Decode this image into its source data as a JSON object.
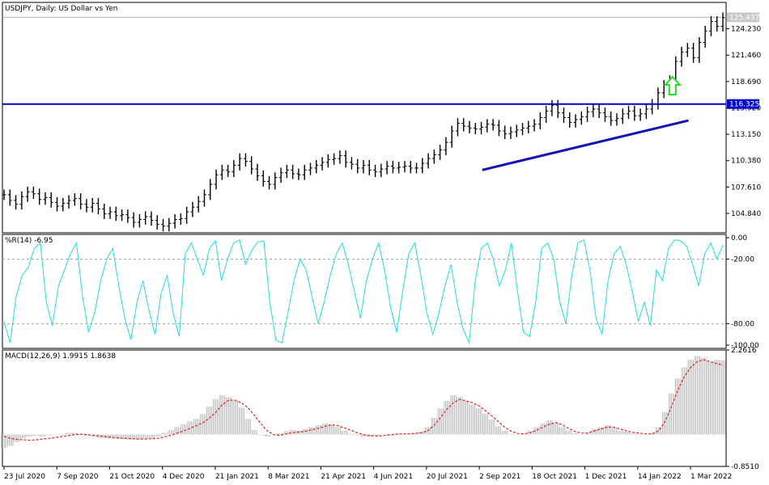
{
  "chart_data": [
    {
      "type": "line",
      "panel": "price",
      "title": "USDJPY, Daily:  US Dollar vs Yen",
      "price_tag": "125.437",
      "level_tag": "116.325",
      "level_value": 116.325,
      "last_value": 125.437,
      "ylim": [
        102.8,
        127.0
      ],
      "y_ticks": [
        {
          "value": 124.23,
          "label": "124.230"
        },
        {
          "value": 121.46,
          "label": "121.460"
        },
        {
          "value": 118.69,
          "label": "118.690"
        },
        {
          "value": 115.92,
          "label": "115.920"
        },
        {
          "value": 113.15,
          "label": "113.150"
        },
        {
          "value": 110.38,
          "label": "110.380"
        },
        {
          "value": 107.61,
          "label": "107.610"
        },
        {
          "value": 104.84,
          "label": "104.840"
        }
      ],
      "trendline": {
        "from": [
          0,
          109.4
        ],
        "to": [
          0.948,
          114.6
        ]
      },
      "arrow_value": 118.0,
      "arrow_x": 0.926,
      "series": [
        {
          "values": [
            106.8,
            106.2,
            105.8,
            106.6,
            107.1,
            106.9,
            106.3,
            106.5,
            106.0,
            105.6,
            105.9,
            106.2,
            106.4,
            105.8,
            105.5,
            105.9,
            105.3,
            104.8,
            105.0,
            104.6,
            104.7,
            104.4,
            103.9,
            104.2,
            104.5,
            104.1,
            103.7,
            103.5,
            103.8,
            104.2,
            104.3,
            105.0,
            105.5,
            106.1,
            106.8,
            107.9,
            108.9,
            109.4,
            109.2,
            109.9,
            110.6,
            110.3,
            109.5,
            108.8,
            108.2,
            107.9,
            108.6,
            109.1,
            109.4,
            109.0,
            108.9,
            109.4,
            109.6,
            109.9,
            110.2,
            110.5,
            110.6,
            110.9,
            110.2,
            110.0,
            109.6,
            109.9,
            109.4,
            109.2,
            109.5,
            109.8,
            109.6,
            109.7,
            109.8,
            109.6,
            109.6,
            110.1,
            110.6,
            111.0,
            111.5,
            112.3,
            113.5,
            114.3,
            114.0,
            113.8,
            113.7,
            113.9,
            114.2,
            114.1,
            113.5,
            113.2,
            113.4,
            113.6,
            113.8,
            114.0,
            114.2,
            114.9,
            115.6,
            116.2,
            115.4,
            114.9,
            114.4,
            114.7,
            115.0,
            115.5,
            115.8,
            115.4,
            115.0,
            114.6,
            114.8,
            115.3,
            115.6,
            115.1,
            115.3,
            115.8,
            116.3,
            117.5,
            118.3,
            118.8,
            120.8,
            121.8,
            122.2,
            121.2,
            122.8,
            124.0,
            125.0,
            124.5,
            125.4
          ]
        }
      ],
      "x_ticks": [
        {
          "pos": 0.0,
          "label": "23 Jul 2020"
        },
        {
          "pos": 0.0769,
          "label": "7 Sep 2020"
        },
        {
          "pos": 0.1538,
          "label": "21 Oct 2020"
        },
        {
          "pos": 0.2308,
          "label": "4 Dec 2020"
        },
        {
          "pos": 0.3077,
          "label": "21 Jan 2021"
        },
        {
          "pos": 0.3846,
          "label": "8 Mar 2021"
        },
        {
          "pos": 0.4615,
          "label": "21 Apr 2021"
        },
        {
          "pos": 0.5385,
          "label": "4 Jun 2021"
        },
        {
          "pos": 0.6154,
          "label": "20 Jul 2021"
        },
        {
          "pos": 0.6923,
          "label": "2 Sep 2021"
        },
        {
          "pos": 0.7692,
          "label": "18 Oct 2021"
        },
        {
          "pos": 0.8462,
          "label": "1 Dec 2021"
        },
        {
          "pos": 0.9231,
          "label": "14 Jan 2022"
        },
        {
          "pos": 1.0,
          "label": "1 Mar 2022"
        }
      ]
    },
    {
      "type": "line",
      "panel": "williams",
      "title": "%R(14) -6.95",
      "ylim": [
        -103,
        3
      ],
      "y_ticks": [
        {
          "value": 0,
          "label": "0.00"
        },
        {
          "value": -20,
          "label": "-20.00"
        },
        {
          "value": -80,
          "label": "-80.00"
        },
        {
          "value": -100,
          "label": "-100.00"
        }
      ],
      "levels": [
        -20,
        -80
      ],
      "series": [
        {
          "values": [
            -78,
            -98,
            -55,
            -35,
            -28,
            -10,
            -5,
            -60,
            -82,
            -45,
            -30,
            -15,
            -5,
            -55,
            -88,
            -70,
            -40,
            -20,
            -10,
            -45,
            -75,
            -95,
            -60,
            -40,
            -68,
            -90,
            -52,
            -35,
            -70,
            -92,
            -15,
            -5,
            -20,
            -35,
            -10,
            -3,
            -40,
            -20,
            -5,
            -2,
            -25,
            -12,
            -4,
            -3,
            -60,
            -95,
            -98,
            -70,
            -40,
            -20,
            -30,
            -55,
            -80,
            -60,
            -35,
            -15,
            -5,
            -25,
            -50,
            -75,
            -40,
            -20,
            -5,
            -30,
            -65,
            -88,
            -50,
            -15,
            -5,
            -35,
            -70,
            -90,
            -70,
            -45,
            -25,
            -60,
            -85,
            -98,
            -40,
            -10,
            -5,
            -20,
            -45,
            -30,
            -5,
            -50,
            -88,
            -92,
            -60,
            -10,
            -5,
            -20,
            -60,
            -80,
            -35,
            -5,
            -2,
            -30,
            -75,
            -90,
            -40,
            -15,
            -8,
            -25,
            -50,
            -78,
            -60,
            -82,
            -30,
            -40,
            -10,
            -2,
            -3,
            -8,
            -25,
            -45,
            -15,
            -5,
            -20,
            -6.95
          ]
        }
      ]
    },
    {
      "type": "bar",
      "panel": "macd",
      "title": "MACD(12,26,9) 1.9915 1.8638",
      "ylim": [
        -0.851,
        2.2616
      ],
      "y_ticks": [
        {
          "value": 2.2616,
          "label": "2.2616"
        },
        {
          "value": -0.851,
          "label": "-0.8510"
        }
      ],
      "series": [
        {
          "values": [
            -0.35,
            -0.3,
            -0.2,
            -0.1,
            -0.05,
            -0.03,
            -0.05,
            -0.02,
            0.0,
            0.02,
            0.05,
            0.05,
            0.02,
            -0.03,
            -0.06,
            -0.09,
            -0.1,
            -0.11,
            -0.12,
            -0.13,
            -0.13,
            -0.13,
            -0.12,
            -0.1,
            -0.05,
            0.05,
            0.12,
            0.2,
            0.28,
            0.35,
            0.42,
            0.55,
            0.75,
            0.95,
            1.05,
            1.0,
            0.9,
            0.72,
            0.42,
            0.12,
            -0.02,
            -0.05,
            0.0,
            0.04,
            0.09,
            0.12,
            0.1,
            0.15,
            0.2,
            0.25,
            0.3,
            0.28,
            0.2,
            0.1,
            0.02,
            -0.02,
            -0.05,
            -0.05,
            -0.03,
            0.0,
            0.02,
            0.03,
            0.02,
            0.03,
            0.05,
            0.08,
            0.2,
            0.45,
            0.7,
            0.9,
            1.05,
            1.0,
            0.9,
            0.8,
            0.7,
            0.55,
            0.4,
            0.22,
            0.1,
            0.02,
            -0.01,
            0.02,
            0.1,
            0.2,
            0.3,
            0.38,
            0.3,
            0.2,
            0.1,
            0.04,
            0.01,
            0.05,
            0.15,
            0.2,
            0.25,
            0.2,
            0.1,
            0.08,
            0.03,
            0.02,
            0.0,
            0.05,
            0.2,
            0.6,
            1.1,
            1.5,
            1.8,
            2.0,
            2.1,
            2.05,
            1.95,
            2.0,
            1.99
          ]
        },
        {
          "values": [
            -0.05,
            -0.1,
            -0.13,
            -0.14,
            -0.15,
            -0.14,
            -0.12,
            -0.1,
            -0.08,
            -0.05,
            -0.03,
            0.0,
            0.01,
            0.0,
            -0.02,
            -0.04,
            -0.06,
            -0.08,
            -0.09,
            -0.1,
            -0.11,
            -0.12,
            -0.12,
            -0.11,
            -0.1,
            -0.06,
            -0.02,
            0.04,
            0.1,
            0.17,
            0.24,
            0.32,
            0.44,
            0.6,
            0.8,
            0.92,
            0.92,
            0.85,
            0.72,
            0.52,
            0.3,
            0.1,
            0.0,
            -0.02,
            0.02,
            0.05,
            0.07,
            0.09,
            0.13,
            0.17,
            0.22,
            0.26,
            0.24,
            0.18,
            0.12,
            0.05,
            0.0,
            -0.03,
            -0.04,
            -0.03,
            -0.01,
            0.01,
            0.02,
            0.02,
            0.03,
            0.05,
            0.1,
            0.25,
            0.45,
            0.68,
            0.85,
            0.94,
            0.9,
            0.85,
            0.77,
            0.64,
            0.5,
            0.35,
            0.2,
            0.09,
            0.03,
            0.02,
            0.05,
            0.12,
            0.2,
            0.28,
            0.32,
            0.26,
            0.16,
            0.08,
            0.04,
            0.04,
            0.1,
            0.15,
            0.2,
            0.2,
            0.15,
            0.1,
            0.06,
            0.04,
            0.02,
            0.02,
            0.1,
            0.35,
            0.75,
            1.2,
            1.55,
            1.8,
            1.95,
            2.0,
            1.95,
            1.9,
            1.86
          ]
        }
      ]
    }
  ]
}
